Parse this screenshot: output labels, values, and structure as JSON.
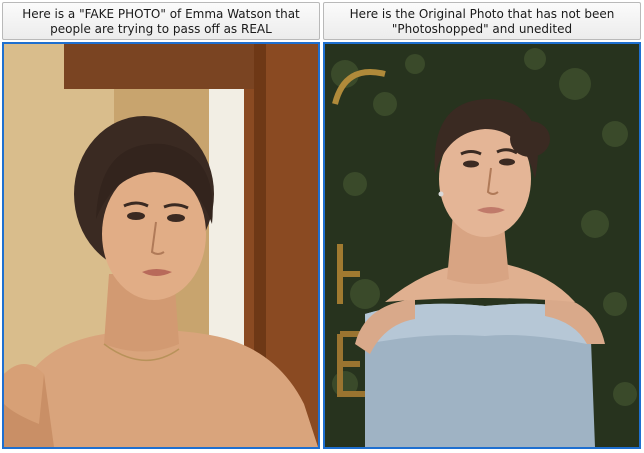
{
  "left_panel": {
    "caption": "Here is a \"FAKE PHOTO\" of Emma Watson that\npeople are trying to pass off as REAL",
    "image": "portrait-photo-fake"
  },
  "right_panel": {
    "caption": "Here is the Original Photo that has not been\n\"Photoshopped\" and unedited",
    "image": "portrait-photo-original"
  },
  "colors": {
    "frame_border": "#1e6fd0",
    "caption_border": "#b9b9b9"
  }
}
